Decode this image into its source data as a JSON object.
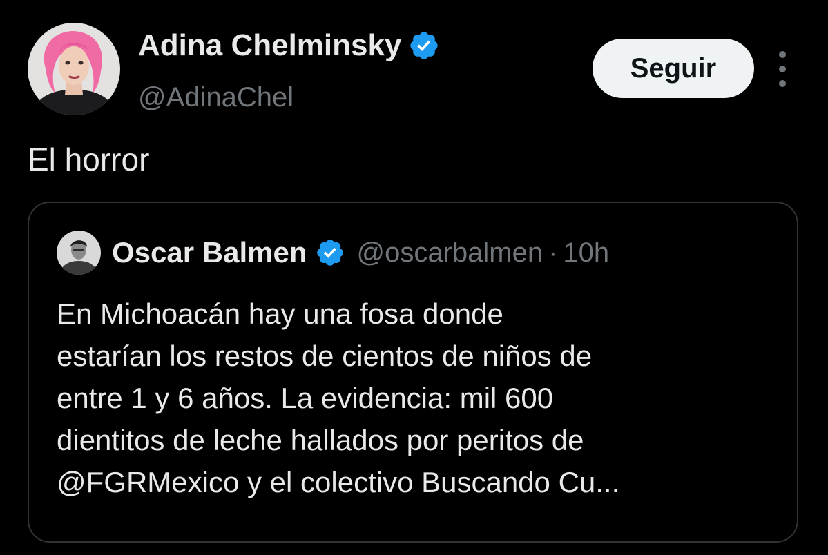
{
  "tweet": {
    "author": {
      "name": "Adina Chelminsky",
      "handle": "@AdinaChel",
      "verified": true
    },
    "follow_label": "Seguir",
    "text": "El horror"
  },
  "quoted": {
    "author": {
      "name": "Oscar Balmen",
      "handle": "@oscarbalmen",
      "separator": "·",
      "time": "10h",
      "verified": true
    },
    "lines": [
      "En Michoacán hay una fosa donde",
      "estarían los restos de cientos de niños de",
      "entre 1 y 6 años. La evidencia: mil 600",
      "dientitos de leche hallados por peritos de",
      "@FGRMexico y el colectivo Buscando Cu..."
    ]
  },
  "colors": {
    "background": "#000000",
    "text_primary": "#e7e9ea",
    "text_secondary": "#71767b",
    "verified_blue": "#1d9bf0",
    "follow_bg": "#eff3f4",
    "card_border": "#2f3336"
  },
  "icons": {
    "verified": "verified-badge-icon",
    "more": "more-options-icon"
  }
}
